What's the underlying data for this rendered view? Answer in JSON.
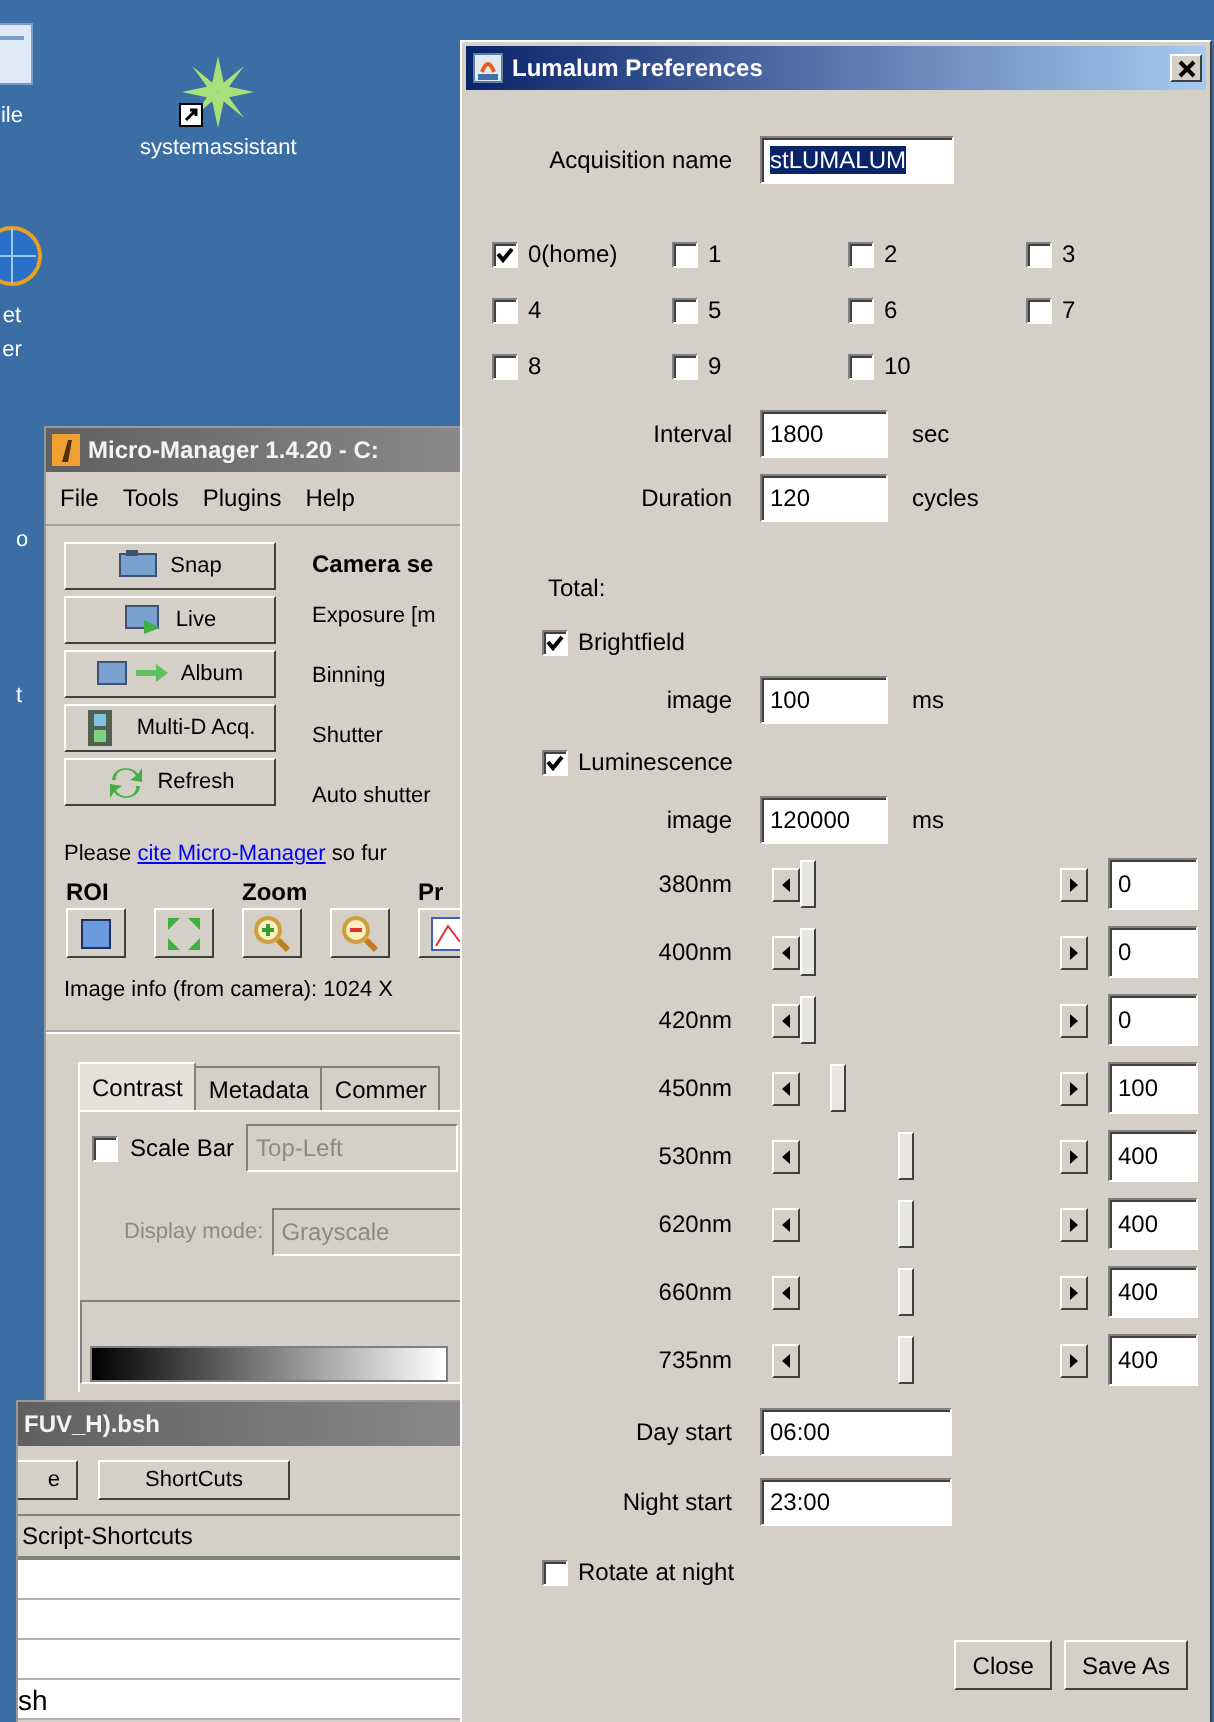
{
  "desktop": {
    "icons": [
      {
        "kind": "document",
        "label_lines": [
          "ile"
        ]
      },
      {
        "kind": "star",
        "label_lines": [
          "systemassistant"
        ]
      },
      {
        "kind": "globe",
        "label_lines": [
          "et",
          "er"
        ]
      },
      {
        "kind": "none",
        "label_lines": [
          "o"
        ]
      },
      {
        "kind": "none",
        "label_lines": [
          "t"
        ]
      }
    ]
  },
  "micro_manager": {
    "title": "Micro-Manager 1.4.20 - C:",
    "menu": [
      "File",
      "Tools",
      "Plugins",
      "Help"
    ],
    "buttons": [
      {
        "kind": "snap",
        "label": "Snap"
      },
      {
        "kind": "live",
        "label": "Live"
      },
      {
        "kind": "album",
        "label": "Album"
      },
      {
        "kind": "multid",
        "label": "Multi-D Acq."
      },
      {
        "kind": "refresh",
        "label": "Refresh"
      }
    ],
    "camera_heading": "Camera se",
    "camera_labels": [
      "Exposure [m",
      "Binning",
      "Shutter",
      "Auto shutter"
    ],
    "cite_before": "Please ",
    "cite_link": "cite Micro-Manager",
    "cite_after": " so fur",
    "tool_groups": [
      {
        "label": "ROI",
        "tools": [
          {
            "kind": "roi"
          },
          {
            "kind": "full"
          }
        ]
      },
      {
        "label": "Zoom",
        "tools": [
          {
            "kind": "zoomin"
          },
          {
            "kind": "zoomout"
          }
        ]
      },
      {
        "label": "Pr",
        "tools": [
          {
            "kind": "chart"
          }
        ]
      }
    ],
    "image_info": "Image info (from camera): 1024 X",
    "tabs": [
      {
        "label": "Contrast",
        "selected": true
      },
      {
        "label": "Metadata",
        "selected": false
      },
      {
        "label": "Commer",
        "selected": false
      }
    ],
    "scale_bar": {
      "label": "Scale Bar",
      "checked": false,
      "position": "Top-Left"
    },
    "display_mode": {
      "label": "Display mode:",
      "value": "Grayscale"
    }
  },
  "script_window": {
    "title": "FUV_H).bsh",
    "buttons": [
      "e",
      "ShortCuts"
    ],
    "tab": "Script-Shortcuts",
    "rows": [
      "",
      "",
      "",
      "sh"
    ]
  },
  "dialog": {
    "title": "Lumalum Preferences",
    "acquisition": {
      "label": "Acquisition name",
      "value": "stLUMALUM",
      "text_selected": true
    },
    "positions": [
      {
        "label": "0(home)",
        "checked": true
      },
      {
        "label": "1",
        "checked": false
      },
      {
        "label": "2",
        "checked": false
      },
      {
        "label": "3",
        "checked": false
      },
      {
        "label": "4",
        "checked": false
      },
      {
        "label": "5",
        "checked": false
      },
      {
        "label": "6",
        "checked": false
      },
      {
        "label": "7",
        "checked": false
      },
      {
        "label": "8",
        "checked": false
      },
      {
        "label": "9",
        "checked": false
      },
      {
        "label": "10",
        "checked": false
      }
    ],
    "interval": {
      "label": "Interval",
      "value": "1800",
      "unit": "sec"
    },
    "duration": {
      "label": "Duration",
      "value": "120",
      "unit": "cycles"
    },
    "total_label": "Total:",
    "modes": [
      {
        "label": "Brightfield",
        "checked": true,
        "image_label": "image",
        "value": "100",
        "unit": "ms"
      },
      {
        "label": "Luminescence",
        "checked": true,
        "image_label": "image",
        "value": "120000",
        "unit": "ms"
      }
    ],
    "wavelengths": [
      {
        "label": "380nm",
        "level": 0,
        "value": "0"
      },
      {
        "label": "400nm",
        "level": 0,
        "value": "0"
      },
      {
        "label": "420nm",
        "level": 0,
        "value": "0"
      },
      {
        "label": "450nm",
        "level": 0.12,
        "value": "100"
      },
      {
        "label": "530nm",
        "level": 0.4,
        "value": "400"
      },
      {
        "label": "620nm",
        "level": 0.4,
        "value": "400"
      },
      {
        "label": "660nm",
        "level": 0.4,
        "value": "400"
      },
      {
        "label": "735nm",
        "level": 0.4,
        "value": "400"
      }
    ],
    "day_start": {
      "label": "Day start",
      "value": "06:00"
    },
    "night_start": {
      "label": "Night start",
      "value": "23:00"
    },
    "rotate": {
      "label": "Rotate at night",
      "checked": false
    },
    "buttons": [
      "Close",
      "Save As"
    ]
  }
}
